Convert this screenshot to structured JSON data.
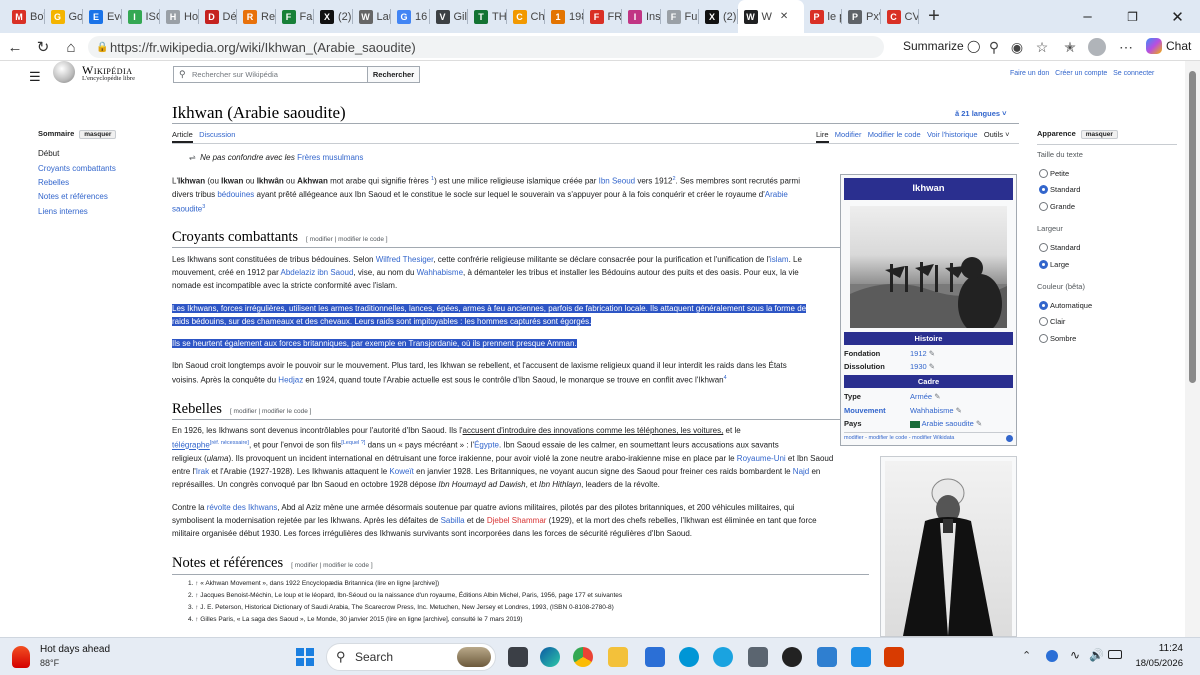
{
  "browser": {
    "tabs": [
      {
        "label": "Boît",
        "fav": "M",
        "color": "#d93025"
      },
      {
        "label": "Goo",
        "fav": "G",
        "color": "#f4b400"
      },
      {
        "label": "Ever",
        "fav": "E",
        "color": "#1a73e8"
      },
      {
        "label": "ISC",
        "fav": "I",
        "color": "#34a853"
      },
      {
        "label": "Hor",
        "fav": "H",
        "color": "#9aa0a6"
      },
      {
        "label": "Déta",
        "fav": "D",
        "color": "#c5221f"
      },
      {
        "label": "Red",
        "fav": "R",
        "color": "#e8710a"
      },
      {
        "label": "Fan",
        "fav": "F",
        "color": "#188038"
      },
      {
        "label": "(2) D",
        "fav": "X",
        "color": "#111111"
      },
      {
        "label": "Laur",
        "fav": "W",
        "color": "#666666"
      },
      {
        "label": "16 n",
        "fav": "G",
        "color": "#4285f4"
      },
      {
        "label": "Gile",
        "fav": "V",
        "color": "#3c4043"
      },
      {
        "label": "THE",
        "fav": "T",
        "color": "#137333"
      },
      {
        "label": "Che",
        "fav": "C",
        "color": "#f29900"
      },
      {
        "label": "198",
        "fav": "1",
        "color": "#e37400"
      },
      {
        "label": "FRA",
        "fav": "F",
        "color": "#d93025"
      },
      {
        "label": "Inst",
        "fav": "I",
        "color": "#c13584"
      },
      {
        "label": "Fun",
        "fav": "F",
        "color": "#9aa0a6"
      },
      {
        "label": "(2)",
        "fav": "X",
        "color": "#111111"
      },
      {
        "label": "W",
        "fav": "W",
        "color": "#202122"
      },
      {
        "label": "le p",
        "fav": "P",
        "color": "#d93025"
      },
      {
        "label": "PxW",
        "fav": "P",
        "color": "#5f6368"
      },
      {
        "label": "CV1",
        "fav": "C",
        "color": "#d93025"
      }
    ],
    "url": "https://fr.wikipedia.org/wiki/Ikhwan_(Arabie_saoudite)",
    "summarize": "Summarize",
    "chat": "Chat"
  },
  "wiki": {
    "logo_title": "Wikipédia",
    "logo_sub": "L'encyclopédie libre",
    "search_placeholder": "Rechercher sur Wikipédia",
    "search_btn": "Rechercher",
    "user_links": [
      "Faire un don",
      "Créer un compte",
      "Se connecter"
    ],
    "title": "Ikhwan (Arabie saoudite)",
    "languages": "21 langues",
    "tabs_left": [
      "Article",
      "Discussion"
    ],
    "tabs_right": [
      "Lire",
      "Modifier",
      "Modifier le code",
      "Voir l'historique",
      "Outils"
    ],
    "sommaire": "Sommaire",
    "masquer": "masquer",
    "toc": [
      "Début",
      "Croyants combattants",
      "Rebelles",
      "Notes et références",
      "Liens internes"
    ],
    "hatnote": "Ne pas confondre avec les",
    "hatnote_link": "Frères musulmans",
    "lead": {
      "s1": "L'",
      "b1": "Ikhwan",
      "s2": " (ou ",
      "b2": "Ikwan",
      "s3": " ou ",
      "b3": "Ikhwân",
      "s4": " ou ",
      "b4": "Akhwan",
      "s5": " mot arabe qui signifie frères ",
      "sup1": "1",
      "s6": ") est une milice religieuse islamique créée par ",
      "l1": "Ibn Seoud",
      "s7": " vers 1912",
      "sup2": "2",
      "s8": ". Ses membres sont recrutés parmi",
      "line2a": "divers tribus ",
      "l2": "bédouines",
      "line2b": " ayant prêté allégeance aux Ibn Saoud et le constitue le socle sur lequel le souverain va s'appuyer pour à la fois conquérir et créer le royaume d'",
      "l3": "Arabie",
      "line3": "saoudite",
      "sup3": "3"
    },
    "sec1": "Croyants combattants",
    "edit_links": "[ modifier | modifier le code ]",
    "p1a": "Les Ikhwans sont constituées de tribus bédouines. Selon ",
    "p1l1": "Wilfred Thesiger",
    "p1b": ", cette confrérie religieuse militante se déclare consacrée pour la purification et l'unification de l'",
    "p1l2": "islam",
    "p1c": ". Le",
    "p1d": "mouvement, créé en 1912 par ",
    "p1l3": "Abdelaziz ibn Saoud",
    "p1e": ", vise, au nom du ",
    "p1l4": "Wahhabisme",
    "p1f": ", à démanteler les tribus et installer les Bédouins autour des puits et des oasis. Pour eux, la vie",
    "p1g": "nomade est incompatible avec la stricte conformité avec l'islam.",
    "hl1a": "Les Ikhwans, forces irrégulières, utilisent les armes traditionnelles, lances, épées, armes à feu anciennes, parfois de fabrication locale. Ils attaquent généralement sous la forme de",
    "hl1b": "raids bédouins, sur des chameaux et des chevaux. Leurs raids sont impitoyables : les hommes capturés sont égorgés.",
    "hl2": "Ils se heurtent également aux forces britanniques, par exemple en Transjordanie, où ils prennent presque Amman.",
    "p3a": "Ibn Saoud croit longtemps avoir le pouvoir sur le mouvement. Plus tard, les Ikhwan se rebellent, et l'accusent de laxisme religieux quand il leur interdit les raids dans les États",
    "p3b": "voisins. Après la conquête du ",
    "p3l": "Hedjaz",
    "p3c": " en 1924, quand toute l'Arabie actuelle est sous le contrôle d'Ibn Saoud, le monarque se trouve en conflit avec l'Ikhwan",
    "p3sup": "4",
    "sec2": "Rebelles",
    "r1a": "En 1926, les Ikhwans sont devenus incontrôlables pour l'autorité d'Ibn Saoud. Ils l'",
    "r1u": "accusent d'introduire des innovations comme les téléphones, les voitures,",
    "r1b": " et le",
    "r2l": "télégraphe",
    "r2sup1": "[réf. nécessaire]",
    "r2a": ", et pour l'envoi de son fils",
    "r2sup2": "[Lequel ?]",
    "r2b": " dans un « pays mécréant » : l'",
    "r2l2": "Égypte",
    "r2c": ". Ibn Saoud essaie de les calmer, en soumettant leurs accusations aux savants",
    "r3a": "religieux (",
    "r3i": "ulama",
    "r3b": "). Ils provoquent un incident international en détruisant une force irakienne, pour avoir violé la zone neutre arabo-irakienne mise en place par le ",
    "r3l": "Royaume-Uni",
    "r3c": " et Ibn Saoud",
    "r4a": "entre l'",
    "r4l1": "Irak",
    "r4b": " et l'Arabie (1927-1928). Les Ikhwanis attaquent le ",
    "r4l2": "Koweït",
    "r4c": " en janvier 1928. Les Britanniques, ne voyant aucun signe des Saoud pour freiner ces raids bombardent le ",
    "r4l3": "Najd",
    "r4d": " en",
    "r5a": "représailles. Un congrès convoqué par Ibn Saoud en octobre 1928 dépose ",
    "r5i1": "Ibn Houmayd ad Dawish",
    "r5b": ", et ",
    "r5i2": "Ibn Hithlayn",
    "r5c": ", leaders de la révolte.",
    "s1a": "Contre la ",
    "s1l": "révolte des Ikhwans",
    "s1b": ", Abd al Aziz mène une armée désormais soutenue par quatre avions militaires, pilotés par des pilotes britanniques, et 200 véhicules militaires, qui",
    "s2a": "symbolisent la modernisation rejetée par les Ikhwans. Après les défaites de ",
    "s2l1": "Sabilla",
    "s2b": " et de ",
    "s2l2": "Djebel Shammar",
    "s2c": " (1929), et la mort des chefs rebelles, l'Ikhwan est éliminée en tant que force",
    "s3": "militaire organisée début 1930. Les forces irrégulières des Ikhwanis survivants sont incorporées dans les forces de sécurité régulières d'Ibn Saoud.",
    "sec3": "Notes et références",
    "refs": [
      "1. ↑ « Akhwan Movement », dans 1922 Encyclopædia Britannica (lire en ligne [archive])",
      "2. ↑ Jacques Benoist-Méchin, Le loup et le léopard, Ibn-Séoud ou la naissance d'un royaume, Éditions Albin Michel, Paris, 1956, page 177 et suivantes",
      "3. ↑ J. E. Peterson, Historical Dictionary of Saudi Arabia, The Scarecrow Press, Inc. Metuchen, New Jersey et Londres, 1993, (ISBN 0-8108-2780-8)",
      "4. ↑ Gilles Paris, « La saga des Saoud », Le Monde, 30 janvier 2015 (lire en ligne [archive], consulté le 7 mars 2019)"
    ],
    "infobox": {
      "title": "Ikhwan",
      "histoire": "Histoire",
      "fondation_k": "Fondation",
      "fondation_v": "1912",
      "dissolution_k": "Dissolution",
      "dissolution_v": "1930",
      "cadre": "Cadre",
      "type_k": "Type",
      "type_v": "Armée",
      "mouvement_k": "Mouvement",
      "mouvement_v": "Wahhabisme",
      "pays_k": "Pays",
      "pays_v": "Arabie saoudite",
      "footer": "modifier - modifier le code - modifier Wikidata"
    },
    "appearance": {
      "title": "Apparence",
      "masquer": "masquer",
      "text_size": "Taille du texte",
      "size_opts": [
        "Petite",
        "Standard",
        "Grande"
      ],
      "width": "Largeur",
      "width_opts": [
        "Standard",
        "Large"
      ],
      "color": "Couleur (bêta)",
      "color_opts": [
        "Automatique",
        "Clair",
        "Sombre"
      ]
    }
  },
  "taskbar": {
    "weather_title": "Hot days ahead",
    "weather_temp": "88°F",
    "search": "Search",
    "time": "11:24",
    "date": "18/05/2026"
  }
}
